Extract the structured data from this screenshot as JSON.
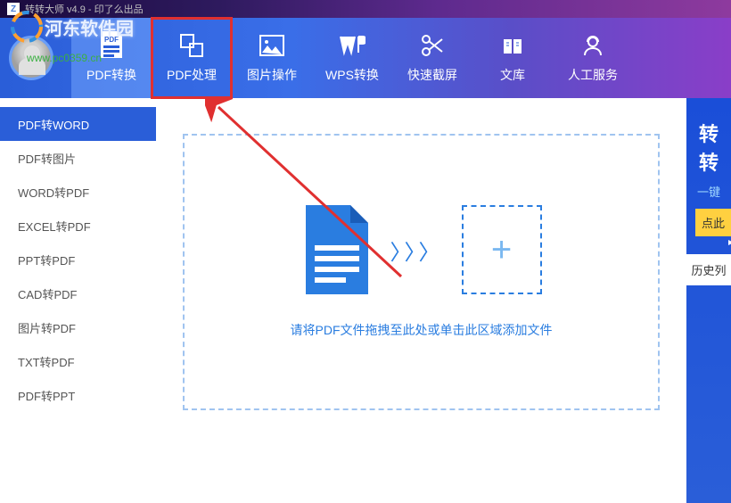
{
  "window": {
    "title": "转转大师 v4.9 - 印了么出品"
  },
  "watermark": {
    "text": "河东软件园",
    "url": "www.pc0359.cn"
  },
  "nav": [
    {
      "label": "PDF转换",
      "icon": "pdf-convert"
    },
    {
      "label": "PDF处理",
      "icon": "pdf-process"
    },
    {
      "label": "图片操作",
      "icon": "image-ops"
    },
    {
      "label": "WPS转换",
      "icon": "wps-convert"
    },
    {
      "label": "快速截屏",
      "icon": "screenshot"
    },
    {
      "label": "文库",
      "icon": "library"
    },
    {
      "label": "人工服务",
      "icon": "support"
    }
  ],
  "sidebar": [
    "PDF转WORD",
    "PDF转图片",
    "WORD转PDF",
    "EXCEL转PDF",
    "PPT转PDF",
    "CAD转PDF",
    "图片转PDF",
    "TXT转PDF",
    "PDF转PPT"
  ],
  "dropzone": {
    "text": "请将PDF文件拖拽至此处或单击此区域添加文件"
  },
  "right_panel": {
    "title": "转转",
    "subtitle": "一键",
    "button": "点此",
    "history": "历史列"
  },
  "colors": {
    "primary": "#2a5ed8",
    "highlight": "#e03030",
    "accent": "#ffd040"
  }
}
